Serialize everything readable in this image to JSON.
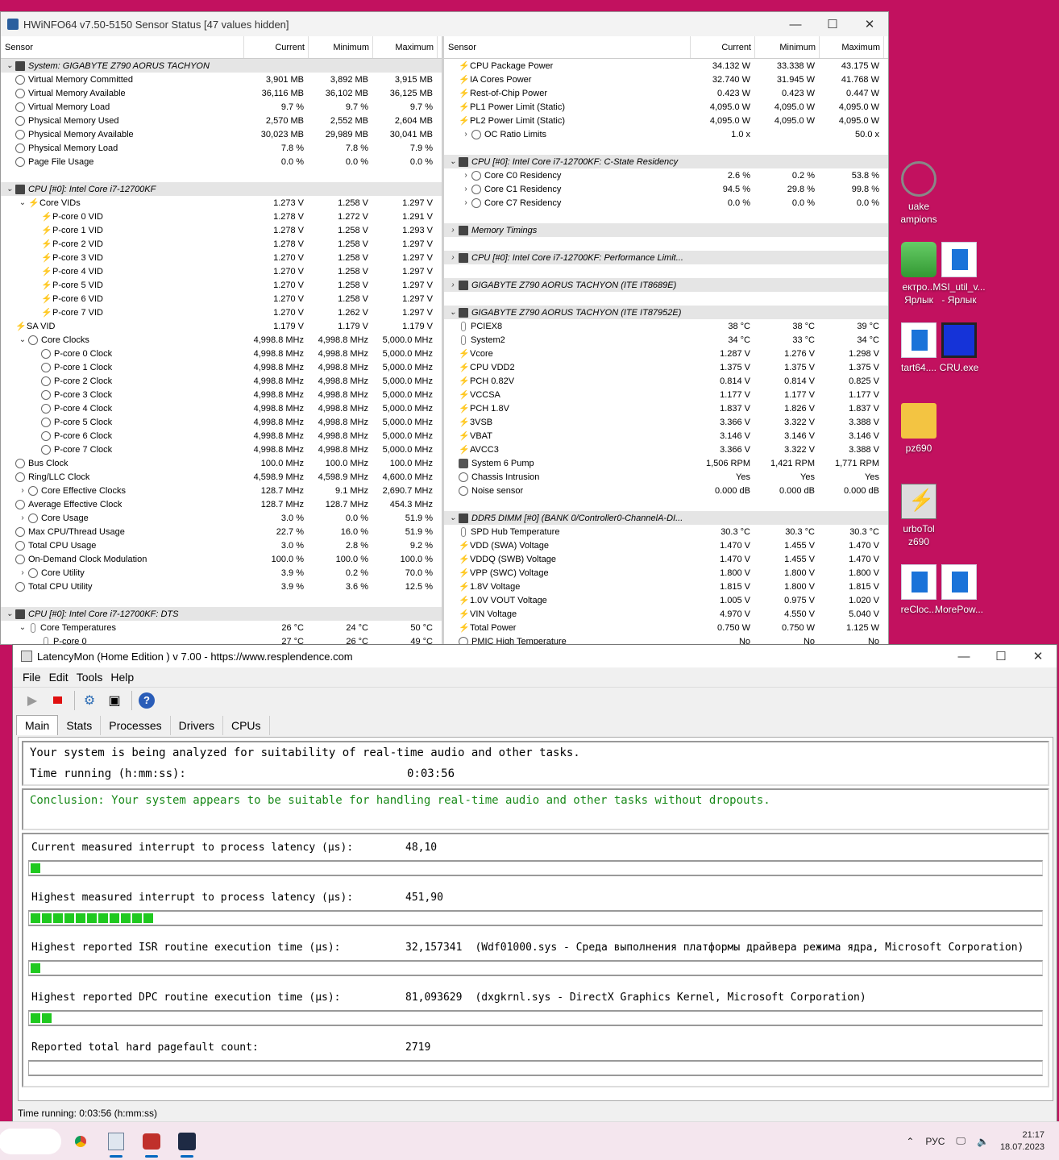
{
  "desktop": {
    "icons": [
      {
        "label": "uake\nampions",
        "kind": "quake"
      },
      {
        "label": "ектро...\nЯрлык",
        "kind": "battery"
      },
      {
        "label": "MSI_util_v...\n- Ярлык",
        "kind": "doc"
      },
      {
        "label": "tart64....",
        "kind": "doc"
      },
      {
        "label": "CRU.exe",
        "kind": "monitor"
      },
      {
        "label": "pz690",
        "kind": "folder"
      },
      {
        "label": "urboTol\nz690",
        "kind": "bolt"
      },
      {
        "label": "reCloc...",
        "kind": "doc"
      },
      {
        "label": "MorePow...",
        "kind": "doc"
      }
    ]
  },
  "hwinfo": {
    "title": "HWiNFO64 v7.50-5150 Sensor Status [47 values hidden]",
    "columns": [
      "Sensor",
      "Current",
      "Minimum",
      "Maximum"
    ],
    "left_rows": [
      {
        "t": "hdr",
        "exp": "v",
        "icon": "chip",
        "name": "System: GIGABYTE Z790 AORUS TACHYON"
      },
      {
        "icon": "clock",
        "name": "Virtual Memory Committed",
        "cur": "3,901 MB",
        "min": "3,892 MB",
        "max": "3,915 MB"
      },
      {
        "icon": "clock",
        "name": "Virtual Memory Available",
        "cur": "36,116 MB",
        "min": "36,102 MB",
        "max": "36,125 MB"
      },
      {
        "icon": "clock",
        "name": "Virtual Memory Load",
        "cur": "9.7 %",
        "min": "9.7 %",
        "max": "9.7 %"
      },
      {
        "icon": "clock",
        "name": "Physical Memory Used",
        "cur": "2,570 MB",
        "min": "2,552 MB",
        "max": "2,604 MB"
      },
      {
        "icon": "clock",
        "name": "Physical Memory Available",
        "cur": "30,023 MB",
        "min": "29,989 MB",
        "max": "30,041 MB"
      },
      {
        "icon": "clock",
        "name": "Physical Memory Load",
        "cur": "7.8 %",
        "min": "7.8 %",
        "max": "7.9 %"
      },
      {
        "icon": "clock",
        "name": "Page File Usage",
        "cur": "0.0 %",
        "min": "0.0 %",
        "max": "0.0 %"
      },
      {
        "t": "blank"
      },
      {
        "t": "hdr",
        "exp": "v",
        "icon": "chip",
        "name": "CPU [#0]: Intel Core i7-12700KF"
      },
      {
        "indent": 1,
        "exp": "v",
        "icon": "bolt",
        "name": "Core VIDs",
        "cur": "1.273 V",
        "min": "1.258 V",
        "max": "1.297 V"
      },
      {
        "indent": 2,
        "icon": "bolt",
        "name": "P-core 0 VID",
        "cur": "1.278 V",
        "min": "1.272 V",
        "max": "1.291 V"
      },
      {
        "indent": 2,
        "icon": "bolt",
        "name": "P-core 1 VID",
        "cur": "1.278 V",
        "min": "1.258 V",
        "max": "1.293 V"
      },
      {
        "indent": 2,
        "icon": "bolt",
        "name": "P-core 2 VID",
        "cur": "1.278 V",
        "min": "1.258 V",
        "max": "1.297 V"
      },
      {
        "indent": 2,
        "icon": "bolt",
        "name": "P-core 3 VID",
        "cur": "1.270 V",
        "min": "1.258 V",
        "max": "1.297 V"
      },
      {
        "indent": 2,
        "icon": "bolt",
        "name": "P-core 4 VID",
        "cur": "1.270 V",
        "min": "1.258 V",
        "max": "1.297 V"
      },
      {
        "indent": 2,
        "icon": "bolt",
        "name": "P-core 5 VID",
        "cur": "1.270 V",
        "min": "1.258 V",
        "max": "1.297 V"
      },
      {
        "indent": 2,
        "icon": "bolt",
        "name": "P-core 6 VID",
        "cur": "1.270 V",
        "min": "1.258 V",
        "max": "1.297 V"
      },
      {
        "indent": 2,
        "icon": "bolt",
        "name": "P-core 7 VID",
        "cur": "1.270 V",
        "min": "1.262 V",
        "max": "1.297 V"
      },
      {
        "icon": "bolt",
        "name": "SA VID",
        "cur": "1.179 V",
        "min": "1.179 V",
        "max": "1.179 V"
      },
      {
        "indent": 1,
        "exp": "v",
        "icon": "clock",
        "name": "Core Clocks",
        "cur": "4,998.8 MHz",
        "min": "4,998.8 MHz",
        "max": "5,000.0 MHz"
      },
      {
        "indent": 2,
        "icon": "clock",
        "name": "P-core 0 Clock",
        "cur": "4,998.8 MHz",
        "min": "4,998.8 MHz",
        "max": "5,000.0 MHz"
      },
      {
        "indent": 2,
        "icon": "clock",
        "name": "P-core 1 Clock",
        "cur": "4,998.8 MHz",
        "min": "4,998.8 MHz",
        "max": "5,000.0 MHz"
      },
      {
        "indent": 2,
        "icon": "clock",
        "name": "P-core 2 Clock",
        "cur": "4,998.8 MHz",
        "min": "4,998.8 MHz",
        "max": "5,000.0 MHz"
      },
      {
        "indent": 2,
        "icon": "clock",
        "name": "P-core 3 Clock",
        "cur": "4,998.8 MHz",
        "min": "4,998.8 MHz",
        "max": "5,000.0 MHz"
      },
      {
        "indent": 2,
        "icon": "clock",
        "name": "P-core 4 Clock",
        "cur": "4,998.8 MHz",
        "min": "4,998.8 MHz",
        "max": "5,000.0 MHz"
      },
      {
        "indent": 2,
        "icon": "clock",
        "name": "P-core 5 Clock",
        "cur": "4,998.8 MHz",
        "min": "4,998.8 MHz",
        "max": "5,000.0 MHz"
      },
      {
        "indent": 2,
        "icon": "clock",
        "name": "P-core 6 Clock",
        "cur": "4,998.8 MHz",
        "min": "4,998.8 MHz",
        "max": "5,000.0 MHz"
      },
      {
        "indent": 2,
        "icon": "clock",
        "name": "P-core 7 Clock",
        "cur": "4,998.8 MHz",
        "min": "4,998.8 MHz",
        "max": "5,000.0 MHz"
      },
      {
        "icon": "clock",
        "name": "Bus Clock",
        "cur": "100.0 MHz",
        "min": "100.0 MHz",
        "max": "100.0 MHz"
      },
      {
        "icon": "clock",
        "name": "Ring/LLC Clock",
        "cur": "4,598.9 MHz",
        "min": "4,598.9 MHz",
        "max": "4,600.0 MHz"
      },
      {
        "indent": 1,
        "exp": ">",
        "icon": "clock",
        "name": "Core Effective Clocks",
        "cur": "128.7 MHz",
        "min": "9.1 MHz",
        "max": "2,690.7 MHz"
      },
      {
        "icon": "clock",
        "name": "Average Effective Clock",
        "cur": "128.7 MHz",
        "min": "128.7 MHz",
        "max": "454.3 MHz"
      },
      {
        "indent": 1,
        "exp": ">",
        "icon": "clock",
        "name": "Core Usage",
        "cur": "3.0 %",
        "min": "0.0 %",
        "max": "51.9 %"
      },
      {
        "icon": "clock",
        "name": "Max CPU/Thread Usage",
        "cur": "22.7 %",
        "min": "16.0 %",
        "max": "51.9 %"
      },
      {
        "icon": "clock",
        "name": "Total CPU Usage",
        "cur": "3.0 %",
        "min": "2.8 %",
        "max": "9.2 %"
      },
      {
        "icon": "clock",
        "name": "On-Demand Clock Modulation",
        "cur": "100.0 %",
        "min": "100.0 %",
        "max": "100.0 %"
      },
      {
        "indent": 1,
        "exp": ">",
        "icon": "clock",
        "name": "Core Utility",
        "cur": "3.9 %",
        "min": "0.2 %",
        "max": "70.0 %"
      },
      {
        "icon": "clock",
        "name": "Total CPU Utility",
        "cur": "3.9 %",
        "min": "3.6 %",
        "max": "12.5 %"
      },
      {
        "t": "blank"
      },
      {
        "t": "hdr",
        "exp": "v",
        "icon": "chip",
        "name": "CPU [#0]: Intel Core i7-12700KF: DTS"
      },
      {
        "indent": 1,
        "exp": "v",
        "icon": "therm",
        "name": "Core Temperatures",
        "cur": "26 °C",
        "min": "24 °C",
        "max": "50 °C"
      },
      {
        "indent": 2,
        "icon": "therm",
        "name": "P-core 0",
        "cur": "27 °C",
        "min": "26 °C",
        "max": "49 °C"
      }
    ],
    "right_rows": [
      {
        "icon": "bolt",
        "name": "CPU Package Power",
        "cur": "34.132 W",
        "min": "33.338 W",
        "max": "43.175 W"
      },
      {
        "icon": "bolt",
        "name": "IA Cores Power",
        "cur": "32.740 W",
        "min": "31.945 W",
        "max": "41.768 W"
      },
      {
        "icon": "bolt",
        "name": "Rest-of-Chip Power",
        "cur": "0.423 W",
        "min": "0.423 W",
        "max": "0.447 W"
      },
      {
        "icon": "bolt",
        "name": "PL1 Power Limit (Static)",
        "cur": "4,095.0 W",
        "min": "4,095.0 W",
        "max": "4,095.0 W"
      },
      {
        "icon": "bolt",
        "name": "PL2 Power Limit (Static)",
        "cur": "4,095.0 W",
        "min": "4,095.0 W",
        "max": "4,095.0 W"
      },
      {
        "indent": 1,
        "exp": ">",
        "icon": "clock",
        "name": "OC Ratio Limits",
        "cur": "1.0 x",
        "min": "",
        "max": "50.0 x"
      },
      {
        "t": "blank"
      },
      {
        "t": "hdr",
        "exp": "v",
        "icon": "chip",
        "name": "CPU [#0]: Intel Core i7-12700KF: C-State Residency"
      },
      {
        "indent": 1,
        "exp": ">",
        "icon": "clock",
        "name": "Core C0 Residency",
        "cur": "2.6 %",
        "min": "0.2 %",
        "max": "53.8 %"
      },
      {
        "indent": 1,
        "exp": ">",
        "icon": "clock",
        "name": "Core C1 Residency",
        "cur": "94.5 %",
        "min": "29.8 %",
        "max": "99.8 %"
      },
      {
        "indent": 1,
        "exp": ">",
        "icon": "clock",
        "name": "Core C7 Residency",
        "cur": "0.0 %",
        "min": "0.0 %",
        "max": "0.0 %"
      },
      {
        "t": "blank"
      },
      {
        "t": "hdr",
        "exp": ">",
        "icon": "chip",
        "name": "Memory Timings"
      },
      {
        "t": "blank"
      },
      {
        "t": "hdr",
        "exp": ">",
        "icon": "chip",
        "name": "CPU [#0]: Intel Core i7-12700KF: Performance Limit..."
      },
      {
        "t": "blank"
      },
      {
        "t": "hdr",
        "exp": ">",
        "icon": "chip",
        "name": "GIGABYTE Z790 AORUS TACHYON (ITE IT8689E)"
      },
      {
        "t": "blank"
      },
      {
        "t": "hdr",
        "exp": "v",
        "icon": "chip",
        "name": "GIGABYTE Z790 AORUS TACHYON (ITE IT87952E)"
      },
      {
        "icon": "therm",
        "name": "PCIEX8",
        "cur": "38 °C",
        "min": "38 °C",
        "max": "39 °C"
      },
      {
        "icon": "therm",
        "name": "System2",
        "cur": "34 °C",
        "min": "33 °C",
        "max": "34 °C"
      },
      {
        "icon": "bolt",
        "name": "Vcore",
        "cur": "1.287 V",
        "min": "1.276 V",
        "max": "1.298 V"
      },
      {
        "icon": "bolt",
        "name": "CPU VDD2",
        "cur": "1.375 V",
        "min": "1.375 V",
        "max": "1.375 V"
      },
      {
        "icon": "bolt",
        "name": "PCH 0.82V",
        "cur": "0.814 V",
        "min": "0.814 V",
        "max": "0.825 V"
      },
      {
        "icon": "bolt",
        "name": "VCCSA",
        "cur": "1.177 V",
        "min": "1.177 V",
        "max": "1.177 V"
      },
      {
        "icon": "bolt",
        "name": "PCH 1.8V",
        "cur": "1.837 V",
        "min": "1.826 V",
        "max": "1.837 V"
      },
      {
        "icon": "bolt",
        "name": "3VSB",
        "cur": "3.366 V",
        "min": "3.322 V",
        "max": "3.388 V"
      },
      {
        "icon": "bolt",
        "name": "VBAT",
        "cur": "3.146 V",
        "min": "3.146 V",
        "max": "3.146 V"
      },
      {
        "icon": "bolt",
        "name": "AVCC3",
        "cur": "3.366 V",
        "min": "3.322 V",
        "max": "3.388 V"
      },
      {
        "icon": "fan",
        "name": "System 6 Pump",
        "cur": "1,506 RPM",
        "min": "1,421 RPM",
        "max": "1,771 RPM"
      },
      {
        "icon": "clock",
        "name": "Chassis Intrusion",
        "cur": "Yes",
        "min": "Yes",
        "max": "Yes"
      },
      {
        "icon": "clock",
        "name": "Noise sensor",
        "cur": "0.000 dB",
        "min": "0.000 dB",
        "max": "0.000 dB"
      },
      {
        "t": "blank"
      },
      {
        "t": "hdr",
        "exp": "v",
        "icon": "chip",
        "name": "DDR5 DIMM [#0] (BANK 0/Controller0-ChannelA-DI..."
      },
      {
        "icon": "therm",
        "name": "SPD Hub Temperature",
        "cur": "30.3 °C",
        "min": "30.3 °C",
        "max": "30.3 °C"
      },
      {
        "icon": "bolt",
        "name": "VDD (SWA) Voltage",
        "cur": "1.470 V",
        "min": "1.455 V",
        "max": "1.470 V"
      },
      {
        "icon": "bolt",
        "name": "VDDQ (SWB) Voltage",
        "cur": "1.470 V",
        "min": "1.455 V",
        "max": "1.470 V"
      },
      {
        "icon": "bolt",
        "name": "VPP (SWC) Voltage",
        "cur": "1.800 V",
        "min": "1.800 V",
        "max": "1.800 V"
      },
      {
        "icon": "bolt",
        "name": "1.8V Voltage",
        "cur": "1.815 V",
        "min": "1.800 V",
        "max": "1.815 V"
      },
      {
        "icon": "bolt",
        "name": "1.0V VOUT Voltage",
        "cur": "1.005 V",
        "min": "0.975 V",
        "max": "1.020 V"
      },
      {
        "icon": "bolt",
        "name": "VIN Voltage",
        "cur": "4.970 V",
        "min": "4.550 V",
        "max": "5.040 V"
      },
      {
        "icon": "bolt",
        "name": "Total Power",
        "cur": "0.750 W",
        "min": "0.750 W",
        "max": "1.125 W"
      },
      {
        "icon": "clock",
        "name": "PMIC High Temperature",
        "cur": "No",
        "min": "No",
        "max": "No"
      }
    ]
  },
  "latencymon": {
    "title": "LatencyMon  (Home Edition )  v 7.00 - https://www.resplendence.com",
    "menu": [
      "File",
      "Edit",
      "Tools",
      "Help"
    ],
    "tabs": [
      "Main",
      "Stats",
      "Processes",
      "Drivers",
      "CPUs"
    ],
    "active_tab": "Main",
    "status_line": "Your system is being analyzed for suitability of real-time audio and other tasks.",
    "time_label": "Time running (h:mm:ss):",
    "time_value": "0:03:56",
    "conclusion": "Conclusion: Your system appears to be suitable for handling real-time audio and other tasks without dropouts.",
    "measurements": [
      {
        "label": "Current measured interrupt to process latency (µs):",
        "value": "48,10",
        "detail": "",
        "bar_segments": 1
      },
      {
        "label": "Highest measured interrupt to process latency (µs):",
        "value": "451,90",
        "detail": "",
        "bar_segments": 11
      },
      {
        "label": "Highest reported ISR routine execution time (µs):",
        "value": "32,157341",
        "detail": "(Wdf01000.sys - Среда выполнения платформы драйвера режима ядра, Microsoft Corporation)",
        "bar_segments": 1
      },
      {
        "label": "Highest reported DPC routine execution time (µs):",
        "value": "81,093629",
        "detail": "(dxgkrnl.sys - DirectX Graphics Kernel, Microsoft Corporation)",
        "bar_segments": 2
      },
      {
        "label": "Reported total hard pagefault count:",
        "value": "2719",
        "detail": "",
        "bar_segments": 0
      }
    ],
    "statusbar": "Time running: 0:03:56  (h:mm:ss)"
  },
  "taskbar": {
    "lang": "РУС",
    "time": "21:17",
    "date": "18.07.2023",
    "apps": [
      "chrome-icon",
      "latencymon-icon",
      "hwinfo-icon",
      "app-icon"
    ]
  }
}
